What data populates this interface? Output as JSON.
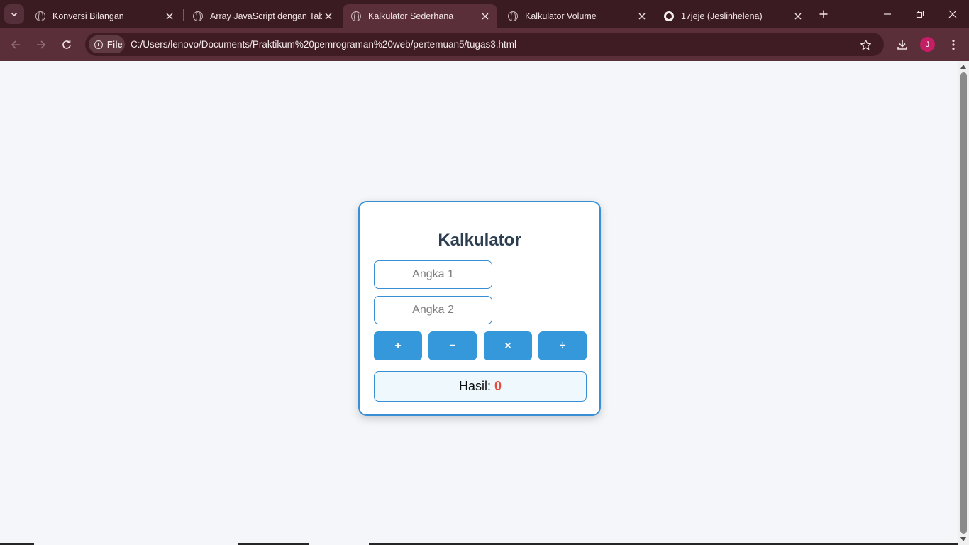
{
  "browser": {
    "tabs": [
      {
        "title": "Konversi Bilangan",
        "favicon": "globe-icon",
        "active": false
      },
      {
        "title": "Array JavaScript dengan Tabel",
        "favicon": "globe-icon",
        "active": false
      },
      {
        "title": "Kalkulator Sederhana",
        "favicon": "globe-icon",
        "active": true
      },
      {
        "title": "Kalkulator Volume",
        "favicon": "globe-icon",
        "active": false
      },
      {
        "title": "17jeje (Jeslinhelena)",
        "favicon": "github-icon",
        "active": false
      }
    ],
    "chip_label": "File",
    "url": "C:/Users/lenovo/Documents/Praktikum%20pemrograman%20web/pertemuan5/tugas3.html",
    "profile_initial": "J",
    "colors": {
      "tabstrip": "#3b1b22",
      "toolbar": "#5b2f39",
      "profile": "#c41e64"
    }
  },
  "calculator": {
    "title": "Kalkulator",
    "input1_placeholder": "Angka 1",
    "input2_placeholder": "Angka 2",
    "ops": {
      "add": "+",
      "subtract": "−",
      "multiply": "×",
      "divide": "÷"
    },
    "result_label": "Hasil:",
    "result_value": "0",
    "colors": {
      "accent": "#3498db",
      "result": "#e74c3c",
      "title": "#2c3e50"
    }
  }
}
